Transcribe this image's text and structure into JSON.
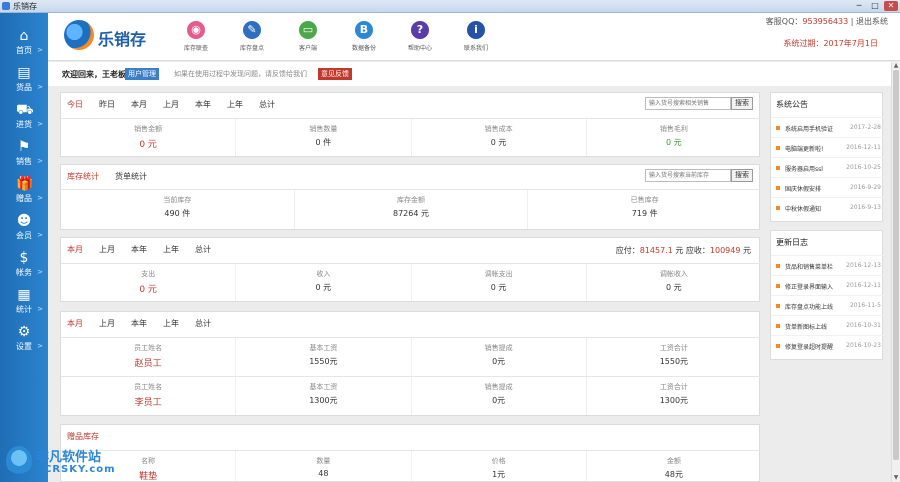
{
  "window": {
    "title": "乐销存",
    "buttons": {
      "min": "─",
      "max": "□",
      "close": "✕"
    }
  },
  "sidebar": {
    "items": [
      {
        "label": "首页",
        "icon": "home-icon",
        "glyph": "⌂"
      },
      {
        "label": "货品",
        "icon": "goods-icon",
        "glyph": "▤"
      },
      {
        "label": "进货",
        "icon": "cart-icon",
        "glyph": "⛟"
      },
      {
        "label": "销售",
        "icon": "sales-icon",
        "glyph": "⚑"
      },
      {
        "label": "赠品",
        "icon": "gift-icon",
        "glyph": "🎁"
      },
      {
        "label": "会员",
        "icon": "member-icon",
        "glyph": "☻"
      },
      {
        "label": "帐务",
        "icon": "money-icon",
        "glyph": "$"
      },
      {
        "label": "统计",
        "icon": "stats-icon",
        "glyph": "▦"
      },
      {
        "label": "设置",
        "icon": "gear-icon",
        "glyph": "⚙"
      }
    ],
    "arrow": ">"
  },
  "header": {
    "logo_text": "乐销存",
    "tools": [
      {
        "label": "库存联查",
        "icon": "inventory-query-icon",
        "color": "#e45c8f",
        "glyph": "◉"
      },
      {
        "label": "库存盘点",
        "icon": "stocktake-icon",
        "color": "#2f6fbf",
        "glyph": "✎"
      },
      {
        "label": "客户端",
        "icon": "client-icon",
        "color": "#4aa84a",
        "glyph": "▭"
      },
      {
        "label": "数据备份",
        "icon": "backup-icon",
        "color": "#2d86d6",
        "glyph": "B"
      },
      {
        "label": "帮助中心",
        "icon": "help-icon",
        "color": "#5a3ba8",
        "glyph": "?"
      },
      {
        "label": "联系我们",
        "icon": "info-icon",
        "color": "#2452a6",
        "glyph": "i"
      }
    ],
    "qq_label": "客服QQ：",
    "qq": "953956433",
    "separator": "|",
    "exit": "退出系统",
    "expire": "系统过期：2017年7月1日"
  },
  "welcome": {
    "text": "欢迎回来，王老板",
    "manage_btn": "用户管理",
    "hint": "如果在使用过程中发现问题，请反馈给我们",
    "feedback_btn": "意见反馈"
  },
  "sales_panel": {
    "tabs": [
      "今日",
      "昨日",
      "本月",
      "上月",
      "本年",
      "上年",
      "总计"
    ],
    "search_placeholder": "输入货号搜索相关销售",
    "search_btn": "搜索",
    "stats": [
      {
        "k": "销售金额",
        "v": "0 元"
      },
      {
        "k": "销售数量",
        "v": "0 件"
      },
      {
        "k": "销售成本",
        "v": "0 元"
      },
      {
        "k": "销售毛利",
        "v": "0 元"
      }
    ]
  },
  "stock_panel": {
    "tabs": [
      "库存统计",
      "货单统计"
    ],
    "search_placeholder": "输入货号搜索当前库存",
    "search_btn": "搜索",
    "stats": [
      {
        "k": "当前库存",
        "v": "490 件"
      },
      {
        "k": "库存金额",
        "v": "87264 元"
      },
      {
        "k": "已售库存",
        "v": "719 件"
      }
    ]
  },
  "finance_panel": {
    "tabs": [
      "本月",
      "上月",
      "本年",
      "上年",
      "总计"
    ],
    "payable_label": "应付：",
    "payable": "81457.1",
    "unit": "元",
    "receivable_label": "应收：",
    "receivable": "100949",
    "stats": [
      {
        "k": "支出",
        "v": "0 元"
      },
      {
        "k": "收入",
        "v": "0 元"
      },
      {
        "k": "调帐支出",
        "v": "0 元"
      },
      {
        "k": "调帐收入",
        "v": "0 元"
      }
    ]
  },
  "staff_panel": {
    "tabs": [
      "本月",
      "上月",
      "本年",
      "上年",
      "总计"
    ],
    "headers": [
      "员工姓名",
      "基本工资",
      "销售提成",
      "工资合计"
    ],
    "rows": [
      [
        "赵员工",
        "1550元",
        "0元",
        "1550元"
      ],
      [
        "李员工",
        "1300元",
        "0元",
        "1300元"
      ]
    ]
  },
  "gift_panel": {
    "title": "赠品库存",
    "headers": [
      "名称",
      "数量",
      "价格",
      "金额"
    ],
    "rows": [
      [
        "鞋垫",
        "48",
        "1元",
        "48元"
      ]
    ]
  },
  "notices": {
    "title": "系统公告",
    "items": [
      {
        "t": "系统启用手机验证",
        "d": "2017-2-28"
      },
      {
        "t": "电脑端更新啦!",
        "d": "2016-12-11"
      },
      {
        "t": "服务器启用ssl",
        "d": "2016-10-25"
      },
      {
        "t": "国庆休假安排",
        "d": "2016-9-29"
      },
      {
        "t": "中秋休假通知",
        "d": "2016-9-13"
      }
    ]
  },
  "changelog": {
    "title": "更新日志",
    "items": [
      {
        "t": "货品和销售菜单栏",
        "d": "2016-12-13"
      },
      {
        "t": "修正登录界面输入",
        "d": "2016-12-11"
      },
      {
        "t": "库存盘点功能上线",
        "d": "2016-11-5"
      },
      {
        "t": "货单新图标上线",
        "d": "2016-10-31"
      },
      {
        "t": "修复登录超时提醒",
        "d": "2016-10-23"
      }
    ]
  },
  "watermark": {
    "line1": "非凡软件站",
    "line2": "CRSKY.com"
  }
}
